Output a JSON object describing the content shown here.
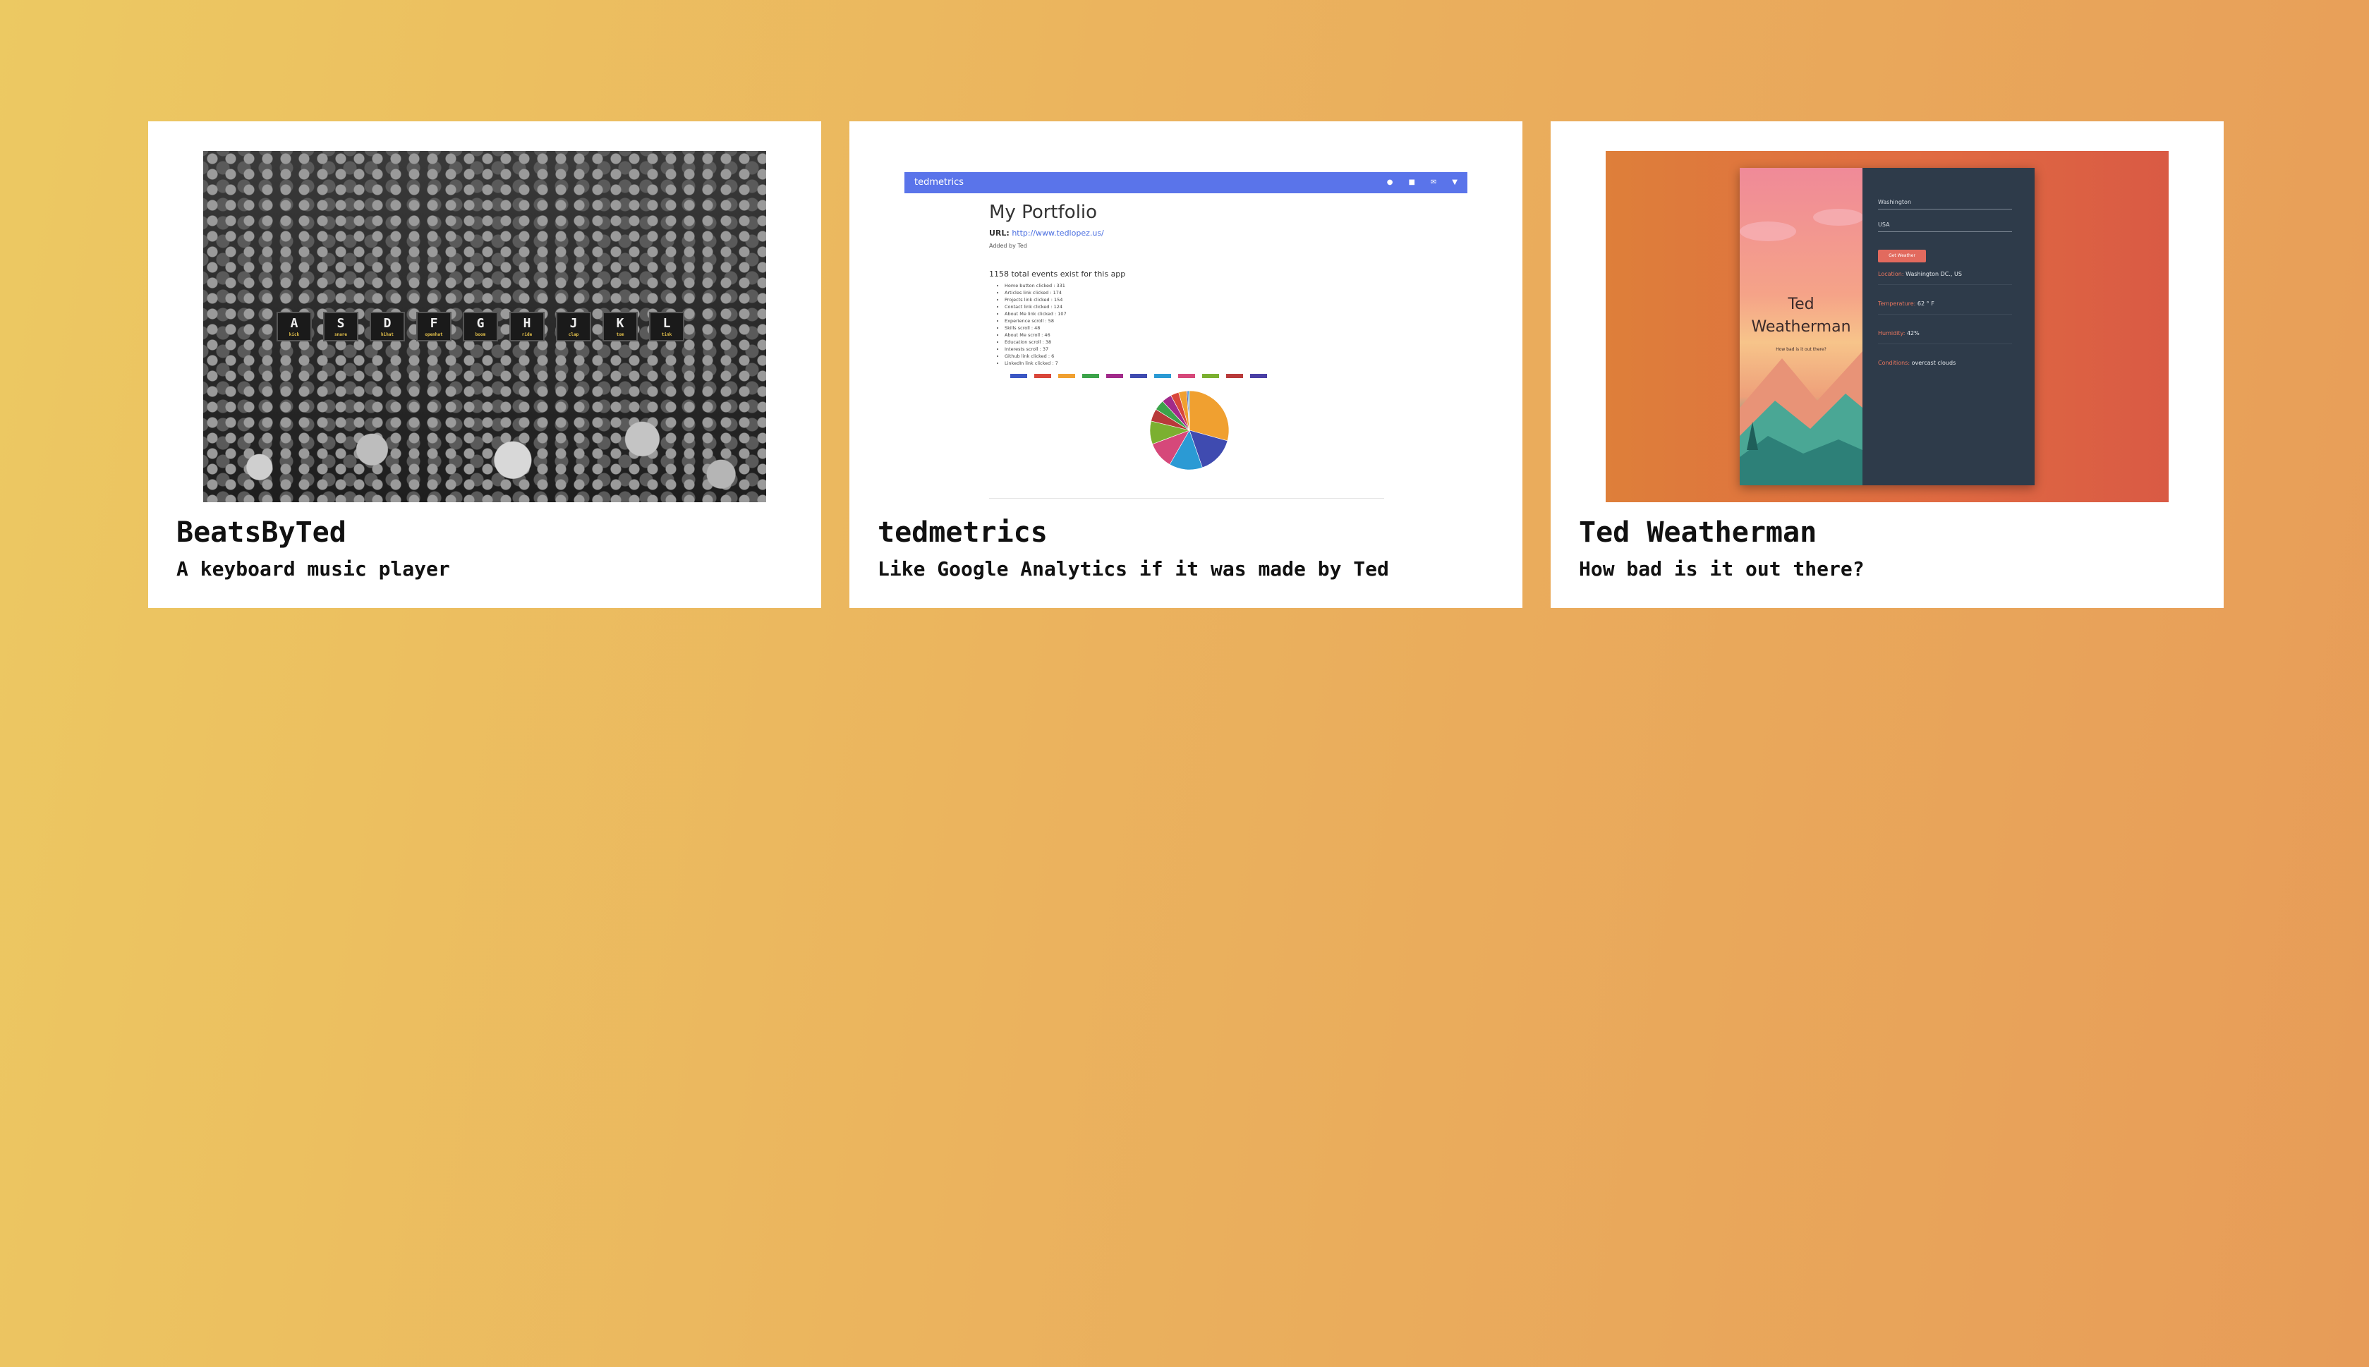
{
  "cards": [
    {
      "title": "BeatsByTed",
      "subtitle": "A keyboard music player",
      "keys": [
        {
          "letter": "A",
          "label": "kick"
        },
        {
          "letter": "S",
          "label": "snare"
        },
        {
          "letter": "D",
          "label": "hihat"
        },
        {
          "letter": "F",
          "label": "openhat"
        },
        {
          "letter": "G",
          "label": "boom"
        },
        {
          "letter": "H",
          "label": "ride"
        },
        {
          "letter": "J",
          "label": "clap"
        },
        {
          "letter": "K",
          "label": "tom"
        },
        {
          "letter": "L",
          "label": "tink"
        }
      ]
    },
    {
      "title": "tedmetrics",
      "subtitle": "Like Google Analytics if it was made by Ted",
      "screen": {
        "app_name": "tedmetrics",
        "heading": "My Portfolio",
        "url_label": "URL:",
        "url": "http://www.tedlopez.us/",
        "added_by": "Added by Ted",
        "events_heading": "1158 total events exist for this app",
        "events": [
          "Home button clicked : 331",
          "Articles link clicked : 174",
          "Projects link clicked : 154",
          "Contact link clicked : 124",
          "About Me link clicked : 107",
          "Experience scroll : 58",
          "Skills scroll : 48",
          "About Me scroll : 46",
          "Education scroll : 38",
          "Interests scroll : 37",
          "Github link clicked : 6",
          "LinkedIn link clicked : 7"
        ],
        "legend_colors": [
          "#3b57c4",
          "#d9463a",
          "#f0a030",
          "#3ca34a",
          "#a12a8a",
          "#3f4bb0",
          "#2b9ad4",
          "#d6487a",
          "#7bb030",
          "#b83a3a",
          "#4a3fa5"
        ],
        "pie_colors": [
          "#f0a030",
          "#3f4bb0",
          "#2b9ad4",
          "#d6487a",
          "#7bb030",
          "#b83a3a",
          "#3ca34a",
          "#a12a8a",
          "#d9463a"
        ]
      }
    },
    {
      "title": "Ted Weatherman",
      "subtitle": "How bad is it out there?",
      "screen": {
        "app_title": "Ted Weatherman",
        "tagline": "How bad is it out there?",
        "city": "Washington",
        "country": "USA",
        "button": "Get Weather",
        "location_label": "Location:",
        "location": "Washington DC., US",
        "temp_label": "Temperature:",
        "temp": "62 ° F",
        "humidity_label": "Humidity:",
        "humidity": "42%",
        "conditions_label": "Conditions:",
        "conditions": "overcast clouds"
      }
    }
  ]
}
